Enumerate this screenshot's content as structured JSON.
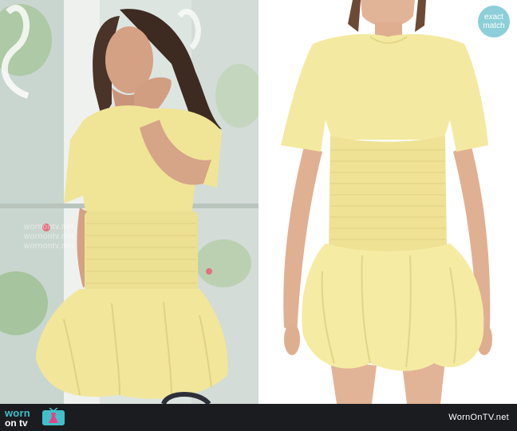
{
  "left_watermark": [
    "wornontv.net",
    "wornontv.net",
    "wornontv.net"
  ],
  "badge": {
    "line1": "exact",
    "line2": "match"
  },
  "footer": {
    "logo_worn": "worn",
    "logo_ontv": "on tv",
    "site_name": "WornOnTV.net"
  },
  "colors": {
    "dress_yellow": "#f3e79c",
    "badge_teal": "#8ccfd8",
    "footer_bg": "#1b1c20",
    "logo_teal": "#3fc1c9",
    "logo_pink": "#e8418c"
  },
  "icons": [
    "tv-dress-logo-icon"
  ]
}
